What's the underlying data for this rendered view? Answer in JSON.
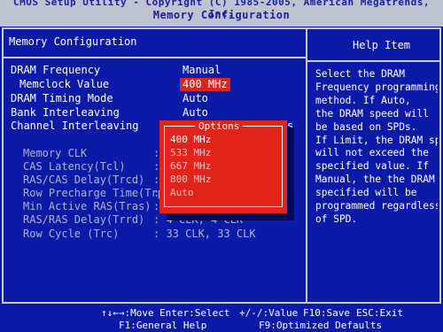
{
  "header": {
    "line1": "CMOS Setup Utility - Copyright (C) 1985-2005, American Megatrends, Inc.",
    "line2": "Memory Configuration"
  },
  "section_title": "Memory Configuration",
  "help_title": "Help Item",
  "settings": [
    {
      "label": "DRAM Frequency",
      "value": "Manual"
    },
    {
      "label": "Memclock Value",
      "value": "400 MHz"
    },
    {
      "label": "DRAM Timing Mode",
      "value": "Auto"
    },
    {
      "label": "Bank Interleaving",
      "value": "Auto"
    },
    {
      "label": "Channel Interleaving",
      "value": "s"
    }
  ],
  "info": [
    {
      "label": "Memory CLK",
      "value": ":"
    },
    {
      "label": "CAS Latency(Tcl)",
      "value": ":"
    },
    {
      "label": "RAS/CAS Delay(Trcd)",
      "value": ":"
    },
    {
      "label": "Row Precharge Time(Trp)",
      "value": ":"
    },
    {
      "label": "Min Active RAS(Tras)",
      "value": ":"
    },
    {
      "label": "RAS/RAS Delay(Trrd)",
      "value": ": 4 CLK, 4 CLK"
    },
    {
      "label": "Row Cycle (Trc)",
      "value": ": 33 CLK, 33 CLK"
    }
  ],
  "popup": {
    "title": "Options",
    "options": [
      "400 MHz",
      "533 MHz",
      "667 MHz",
      "800 MHz",
      "Auto"
    ],
    "selected": "400 MHz"
  },
  "help_lines": [
    "Select the DRAM",
    "Frequency programming",
    "method. If Auto,",
    "the DRAM speed will",
    "be based on SPDs.",
    "If Limit, the DRAM spe",
    "will not exceed the",
    "specified value. If",
    "Manual, the the DRAM s",
    "specified will be",
    "programmed regardless",
    "of SPD."
  ],
  "footer": {
    "move": "↑↓←→:Move",
    "select": "Enter:Select",
    "value": "+/-/:Value",
    "save": "F10:Save",
    "exit": "ESC:Exit",
    "help": "F1:General Help",
    "defaults": "F9:Optimized Defaults"
  },
  "colors": {
    "background": "#0c1aa8",
    "highlight": "#e2231a",
    "header_bar": "#bfc3cf",
    "header_text": "#1a1fa0"
  }
}
